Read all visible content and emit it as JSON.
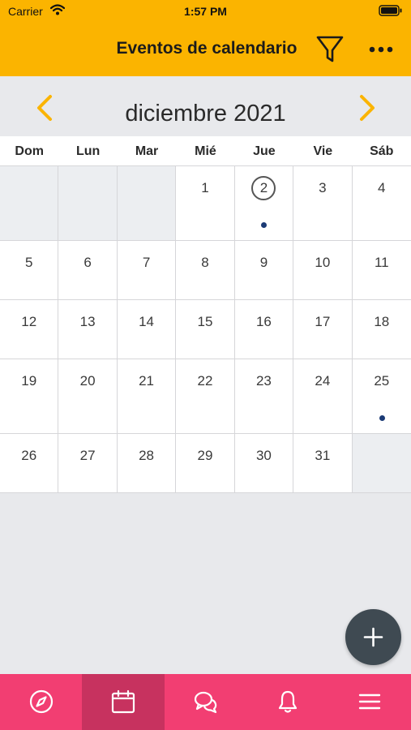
{
  "status_bar": {
    "carrier": "Carrier",
    "time": "1:57 PM"
  },
  "header": {
    "title": "Eventos de calendario"
  },
  "calendar": {
    "month_label": "diciembre 2021",
    "weekdays": [
      "Dom",
      "Lun",
      "Mar",
      "Mié",
      "Jue",
      "Vie",
      "Sáb"
    ],
    "today": 2,
    "event_days": [
      2,
      25
    ],
    "cells": [
      "",
      "",
      "",
      "1",
      "2",
      "3",
      "4",
      "5",
      "6",
      "7",
      "8",
      "9",
      "10",
      "11",
      "12",
      "13",
      "14",
      "15",
      "16",
      "17",
      "18",
      "19",
      "20",
      "21",
      "22",
      "23",
      "24",
      "25",
      "26",
      "27",
      "28",
      "29",
      "30",
      "31",
      ""
    ]
  },
  "tabs": [
    {
      "icon": "compass-icon",
      "active": false
    },
    {
      "icon": "calendar-icon",
      "active": true
    },
    {
      "icon": "chat-icon",
      "active": false
    },
    {
      "icon": "bell-icon",
      "active": false
    },
    {
      "icon": "menu-icon",
      "active": false
    }
  ],
  "colors": {
    "header": "#fbb400",
    "accent_arrow": "#fbb400",
    "tabbar": "#f23e72",
    "tab_active": "#c7325f",
    "event_dot": "#1b3a75",
    "fab": "#3f4a52"
  }
}
